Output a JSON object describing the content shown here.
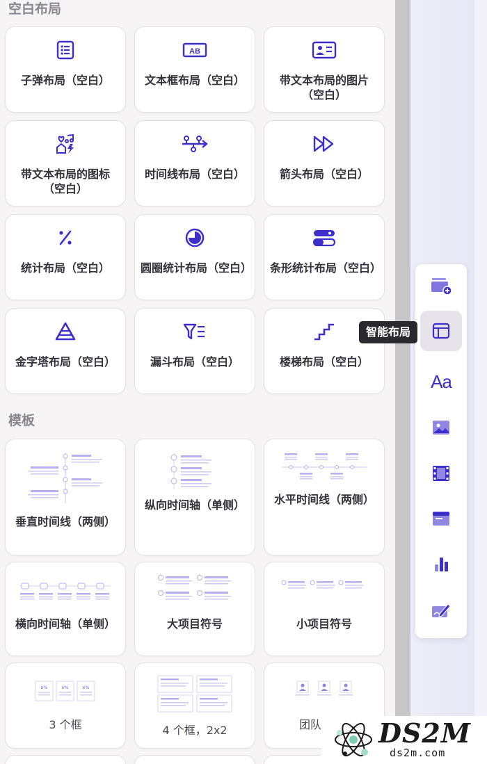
{
  "sections": {
    "blank_layouts_title": "空白布局",
    "templates_title": "模板"
  },
  "layouts": [
    {
      "label": "子弹布局（空白）",
      "icon": "bulleted-list-icon"
    },
    {
      "label": "文本框布局（空白）",
      "icon": "text-box-icon"
    },
    {
      "label": "带文本布局的图片（空白）",
      "icon": "image-with-text-icon"
    },
    {
      "label": "带文本布局的图标（空白）",
      "icon": "icons-with-text-icon"
    },
    {
      "label": "时间线布局（空白）",
      "icon": "timeline-icon"
    },
    {
      "label": "箭头布局（空白）",
      "icon": "arrow-icon"
    },
    {
      "label": "统计布局（空白）",
      "icon": "percent-icon"
    },
    {
      "label": "圆圈统计布局（空白）",
      "icon": "circle-stat-icon"
    },
    {
      "label": "条形统计布局（空白）",
      "icon": "bar-stat-icon"
    },
    {
      "label": "金字塔布局（空白）",
      "icon": "pyramid-icon"
    },
    {
      "label": "漏斗布局（空白）",
      "icon": "funnel-icon"
    },
    {
      "label": "楼梯布局（空白）",
      "icon": "stairs-icon"
    }
  ],
  "templates": [
    {
      "label": "垂直时间线（两侧）"
    },
    {
      "label": "纵向时间轴（单侧）"
    },
    {
      "label": "水平时间线（两侧）"
    },
    {
      "label": "横向时间轴（单侧）"
    },
    {
      "label": "大项目符号"
    },
    {
      "label": "小项目符号"
    },
    {
      "label": "3 个框"
    },
    {
      "label": "4 个框，2x2"
    },
    {
      "label": "团队"
    }
  ],
  "toolbar": {
    "items": [
      {
        "icon": "add-slide-icon"
      },
      {
        "icon": "smart-layout-icon",
        "active": true
      },
      {
        "icon": "text-style-icon",
        "text": "Aa"
      },
      {
        "icon": "image-icon"
      },
      {
        "icon": "video-icon"
      },
      {
        "icon": "embed-icon"
      },
      {
        "icon": "chart-icon"
      },
      {
        "icon": "edit-icon"
      }
    ],
    "tooltip": "智能布局"
  },
  "watermark": {
    "title": "DS2M",
    "url": "ds2m.com"
  },
  "colors": {
    "accent": "#3d2fc9",
    "light_accent": "#b6b0ee"
  }
}
